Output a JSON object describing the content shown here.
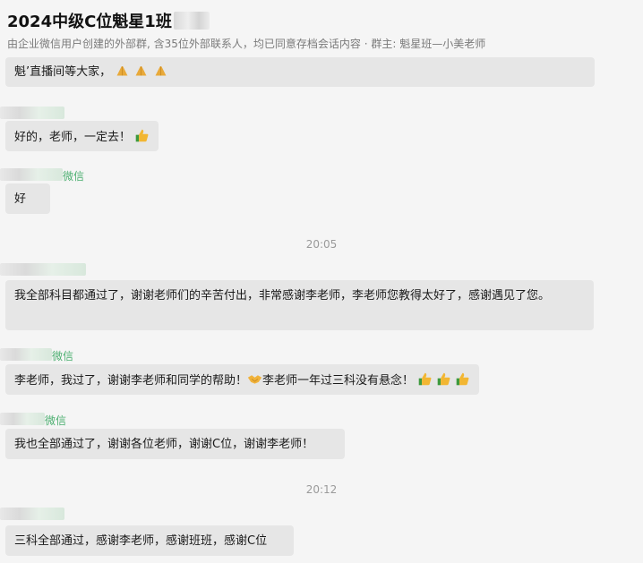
{
  "header": {
    "title": "2024中级C位魁星1班",
    "subtitle": "由企业微信用户创建的外部群, 含35位外部联系人，均已同意存档会话内容 · 群主: 魁星班—小美老师"
  },
  "messages": [
    {
      "type": "text",
      "text": "魁’直播间等大家，",
      "icons": [
        "pray-icon",
        "pray-icon",
        "pray-icon"
      ]
    },
    {
      "type": "text",
      "sender_suffix": "",
      "text": "好的，老师，一定去！",
      "icons": [
        "thumbs-up-icon"
      ]
    },
    {
      "type": "text",
      "sender_suffix": "微信",
      "text": "好"
    },
    {
      "type": "time",
      "text": "20:05"
    },
    {
      "type": "text",
      "sender_suffix": "",
      "text": "我全部科目都通过了，谢谢老师们的辛苦付出，非常感谢李老师，李老师您教得太好了，感谢遇见了您。"
    },
    {
      "type": "text",
      "sender_suffix": "微信",
      "text_a": "李老师，我过了，谢谢李老师和同学的帮助！",
      "text_b": "李老师一年过三科没有悬念！"
    },
    {
      "type": "text",
      "sender_suffix": "微信",
      "text": "我也全部通过了，谢谢各位老师，谢谢C位，谢谢李老师！"
    },
    {
      "type": "time",
      "text": "20:12"
    },
    {
      "type": "text",
      "sender_suffix": "",
      "text": "三科全部通过，感谢李老师，感谢班班，感谢C位"
    }
  ],
  "colors": {
    "bubble": "#e6e6e6",
    "sender": "#4caf70",
    "time": "#9a9a9a"
  }
}
